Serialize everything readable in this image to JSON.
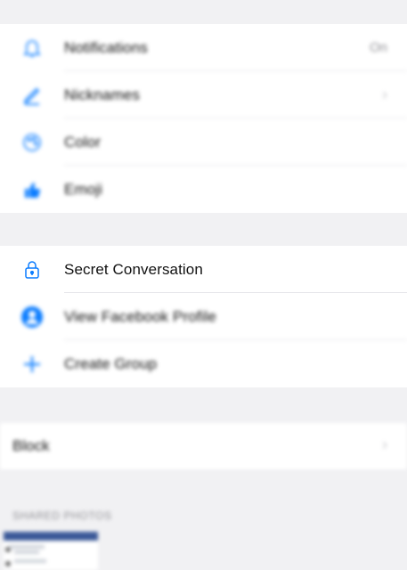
{
  "settings_top": {
    "items": [
      {
        "label": "Notifications",
        "value": "On",
        "icon": "bell-icon"
      },
      {
        "label": "Nicknames",
        "value": "",
        "icon": "pencil-icon"
      },
      {
        "label": "Color",
        "value": "",
        "icon": "palette-icon"
      },
      {
        "label": "Emoji",
        "value": "",
        "icon": "thumbs-up-icon"
      }
    ]
  },
  "settings_mid": {
    "items": [
      {
        "label": "Secret Conversation",
        "icon": "lock-icon"
      },
      {
        "label": "View Facebook Profile",
        "icon": "profile-icon"
      },
      {
        "label": "Create Group",
        "icon": "plus-icon"
      }
    ]
  },
  "block": {
    "label": "Block"
  },
  "shared_photos": {
    "header": "SHARED PHOTOS"
  },
  "colors": {
    "accent": "#0a7cff",
    "background": "#f1f1f3"
  }
}
